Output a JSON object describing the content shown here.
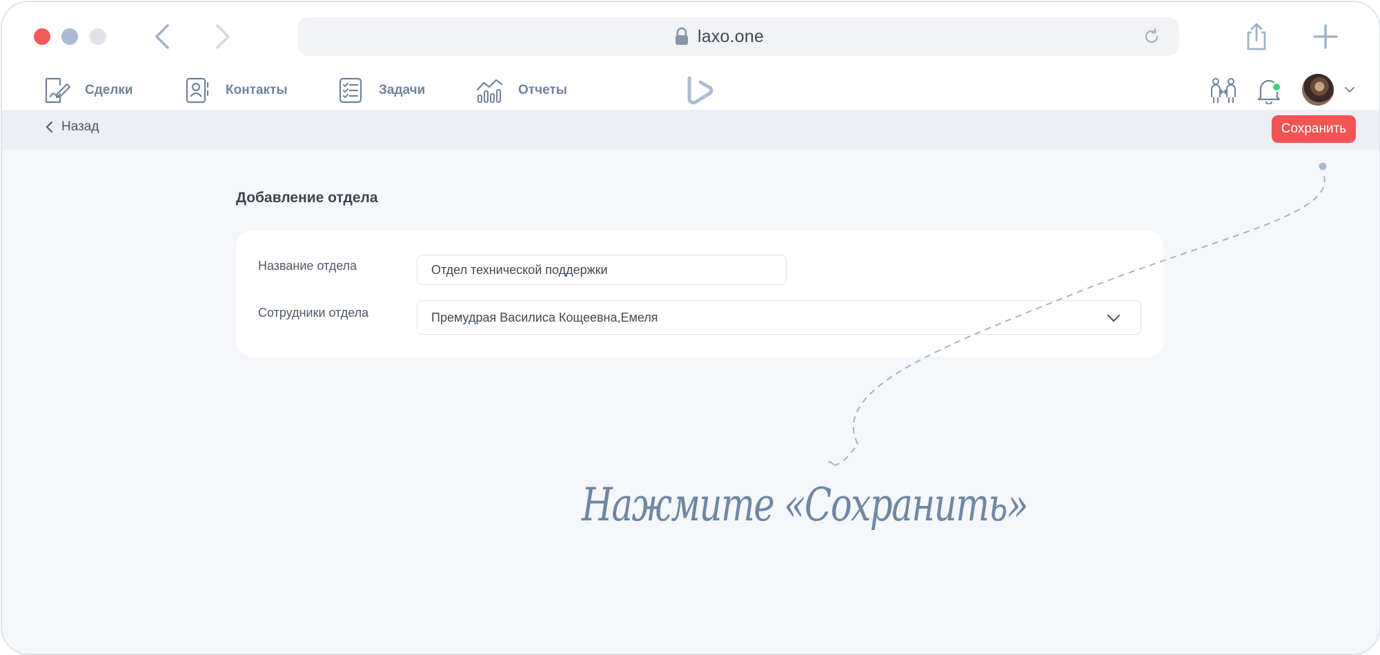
{
  "browser": {
    "url": "laxo.one",
    "icons": {
      "back": "chevron-left-icon",
      "forward": "chevron-right-icon",
      "lock": "lock-icon",
      "reload": "reload-icon",
      "share": "share-icon",
      "new_tab": "plus-icon"
    }
  },
  "nav": {
    "items": [
      {
        "label": "Сделки",
        "icon": "deals-icon"
      },
      {
        "label": "Контакты",
        "icon": "contacts-icon"
      },
      {
        "label": "Задачи",
        "icon": "tasks-icon"
      },
      {
        "label": "Отчеты",
        "icon": "reports-icon"
      }
    ],
    "right_icons": [
      "team-icon",
      "bell-icon",
      "avatar",
      "chevron-down-icon"
    ]
  },
  "toolbar": {
    "back_label": "Назад",
    "save_label": "Сохранить"
  },
  "form": {
    "title": "Добавление отдела",
    "name_label": "Название отдела",
    "name_value": "Отдел технической поддержки",
    "staff_label": "Сотрудники отдела",
    "staff_value": "Премудрая Василиса Кощеевна,Емеля"
  },
  "hint": {
    "text": "Нажмите «Сохранить»"
  },
  "colors": {
    "accent_red": "#f25454",
    "nav_text": "#6e829a",
    "background": "#f4f6f9",
    "hint": "#6e87a3"
  }
}
